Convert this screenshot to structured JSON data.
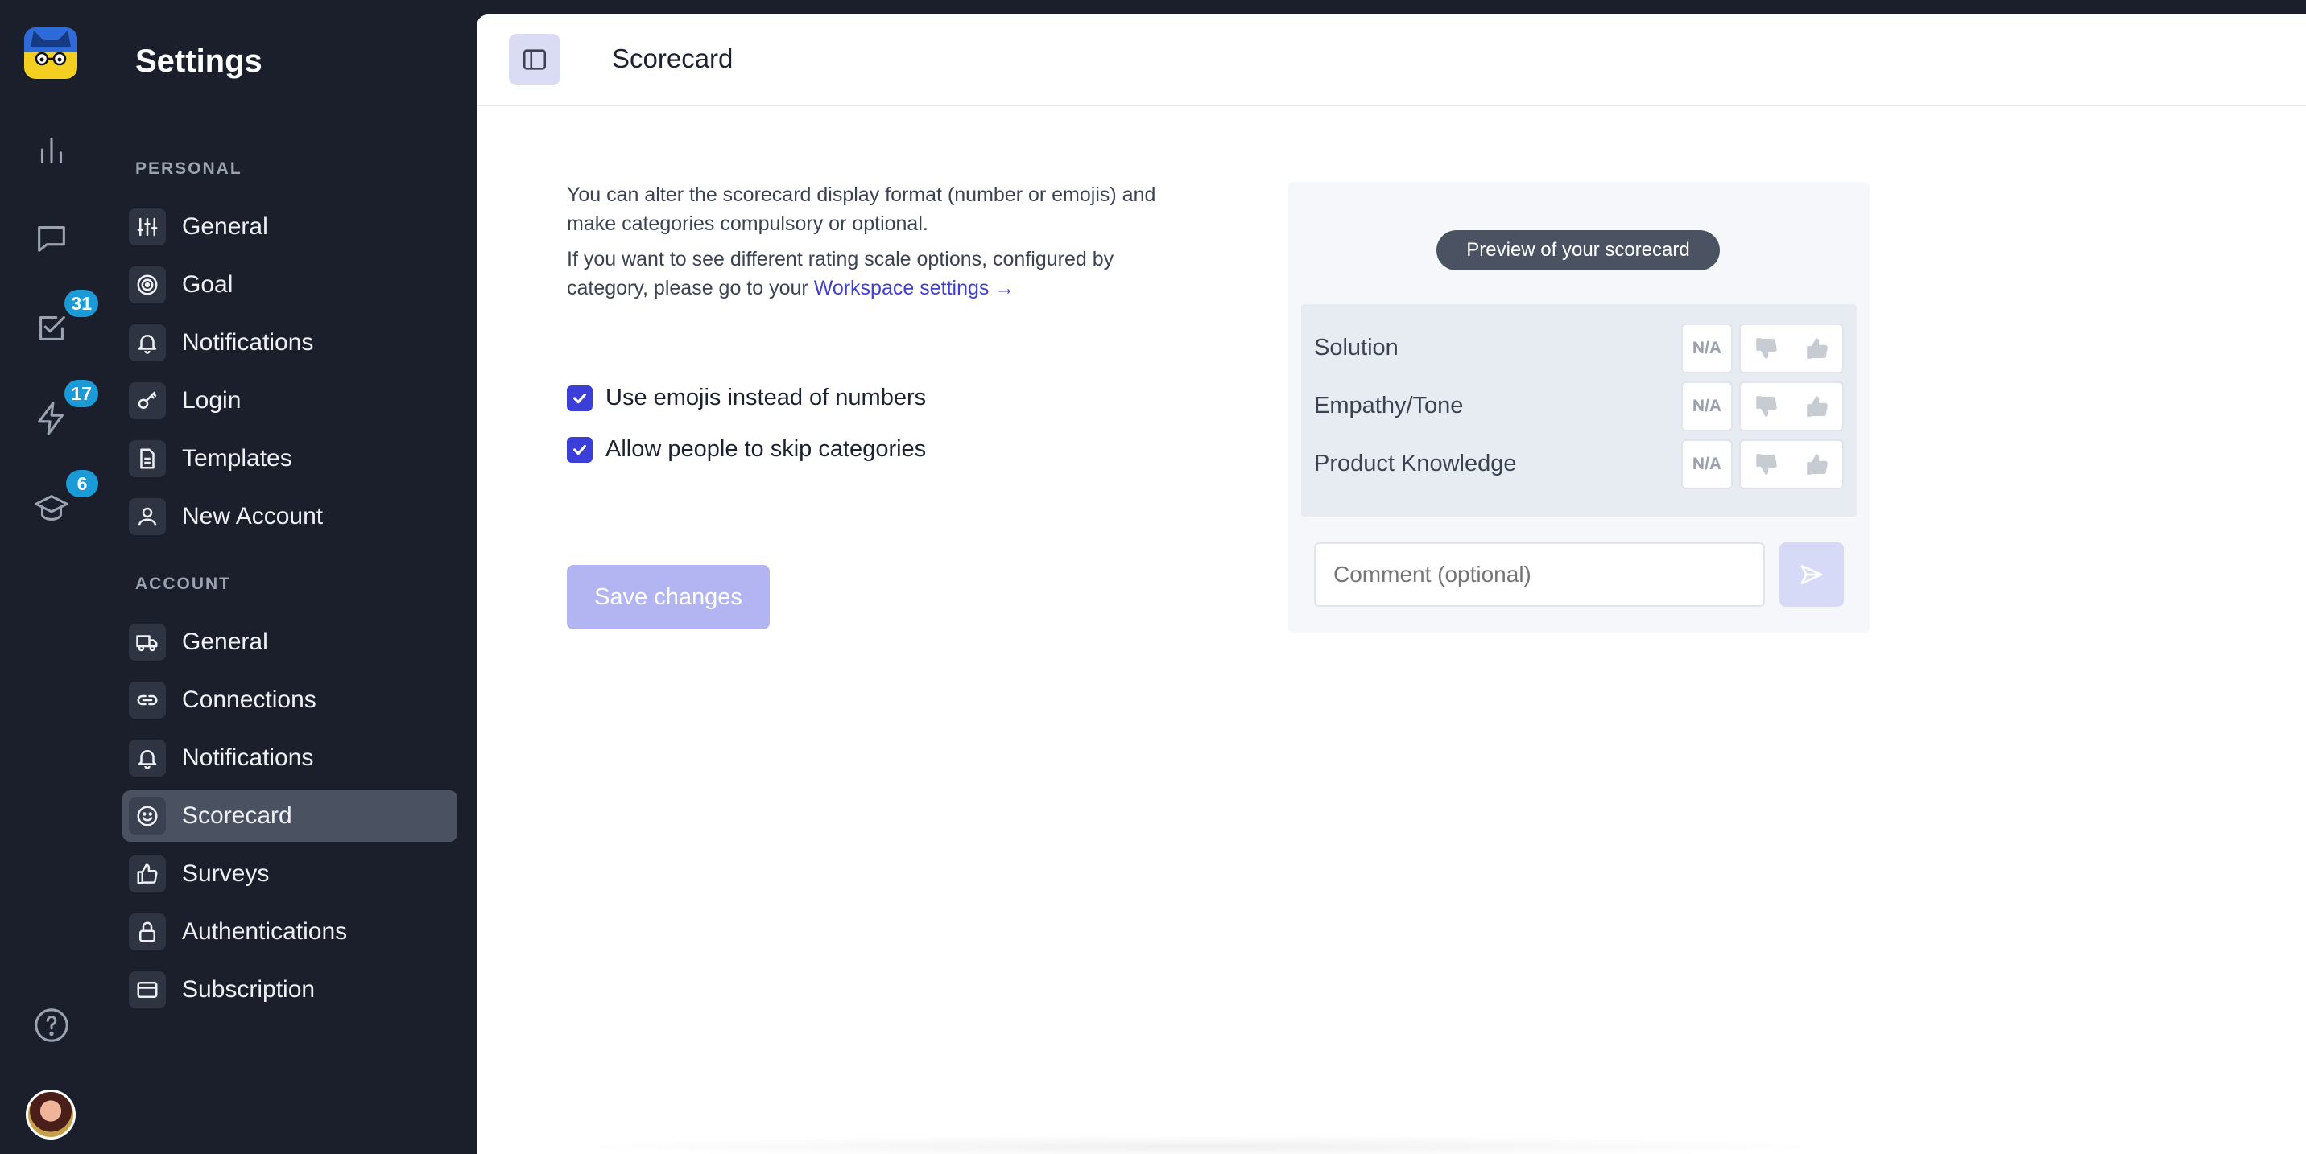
{
  "rail": {
    "badges": {
      "tasks": "31",
      "activity": "17",
      "learning": "6"
    }
  },
  "nav": {
    "title": "Settings",
    "personal_heading": "PERSONAL",
    "personal": [
      {
        "label": "General",
        "icon": "sliders-icon"
      },
      {
        "label": "Goal",
        "icon": "target-icon"
      },
      {
        "label": "Notifications",
        "icon": "bell-icon"
      },
      {
        "label": "Login",
        "icon": "key-icon"
      },
      {
        "label": "Templates",
        "icon": "document-icon"
      },
      {
        "label": "New Account",
        "icon": "user-icon"
      }
    ],
    "account_heading": "ACCOUNT",
    "account": [
      {
        "label": "General",
        "icon": "truck-icon"
      },
      {
        "label": "Connections",
        "icon": "link-icon"
      },
      {
        "label": "Notifications",
        "icon": "bell-icon"
      },
      {
        "label": "Scorecard",
        "icon": "smiley-icon",
        "active": true
      },
      {
        "label": "Surveys",
        "icon": "thumbs-up-icon"
      },
      {
        "label": "Authentications",
        "icon": "lock-icon"
      },
      {
        "label": "Subscription",
        "icon": "credit-card-icon"
      }
    ]
  },
  "header": {
    "title": "Scorecard"
  },
  "content": {
    "desc_line1": "You can alter the scorecard display format (number or emojis) and",
    "desc_line2": "make categories compulsory or optional.",
    "desc_line3": "If you want to see different rating scale options, configured by",
    "desc_line4_prefix": "category, please go to your",
    "workspace_link": "Workspace settings →",
    "option_emojis": "Use emojis instead of numbers",
    "option_skip": "Allow people to skip categories",
    "save_label": "Save changes"
  },
  "preview": {
    "pill": "Preview of your scorecard",
    "categories": [
      "Solution",
      "Empathy/Tone",
      "Product Knowledge"
    ],
    "na_label": "N/A",
    "comment_placeholder": "Comment (optional)"
  },
  "colors": {
    "accent": "#3b3fd8",
    "sidebar": "#1b1f2b",
    "badge": "#1a9ad6",
    "link": "#3f3fcf"
  }
}
